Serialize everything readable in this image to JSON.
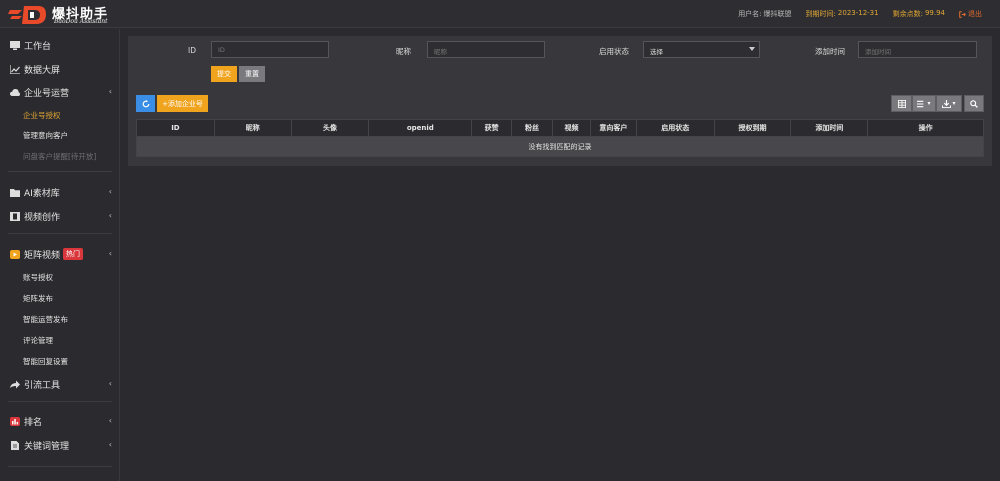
{
  "brand": {
    "title": "爆抖助手",
    "subtitle": "BaoDou Assistant"
  },
  "top": {
    "user_label": "用户名:",
    "user_value": "爆抖联盟",
    "expire_label": "到期时间:",
    "expire_value": "2023-12-31",
    "points_label": "剩余点数:",
    "points_value": "99.94",
    "logout": "退出"
  },
  "sidebar": {
    "workbench": "工作台",
    "datascreen": "数据大屏",
    "enterprise": "企业号运营",
    "enterprise_sub": [
      "企业号授权",
      "管理意向客户",
      "问盘客户提醒[待开放]"
    ],
    "ai_material": "AI素材库",
    "video_create": "视频创作",
    "matrix_video": "矩阵视频",
    "hot_badge": "热门",
    "matrix_sub": [
      "账号授权",
      "矩阵发布",
      "智能运营发布",
      "评论管理",
      "智能回复设置"
    ],
    "traffic_tools": "引流工具",
    "ranking": "排名",
    "keywords": "关键词管理"
  },
  "filters": {
    "id_label": "ID",
    "id_placeholder": "ID",
    "nickname_label": "昵称",
    "nickname_placeholder": "昵称",
    "status_label": "启用状态",
    "status_value": "选择",
    "time_label": "添加时间",
    "time_placeholder": "添加时间",
    "submit": "提交",
    "reset": "重置"
  },
  "toolbar": {
    "add": "+添加企业号"
  },
  "table": {
    "columns": [
      "ID",
      "昵称",
      "头像",
      "openid",
      "获赞",
      "粉丝",
      "视频",
      "意向客户",
      "启用状态",
      "授权到期",
      "添加时间",
      "操作"
    ],
    "empty": "没有找到匹配的记录"
  },
  "colors": {
    "accent": "#f0a31d",
    "primary_blue": "#3a8ee6",
    "hot": "#d9373c",
    "gold_text": "#e2a732"
  }
}
